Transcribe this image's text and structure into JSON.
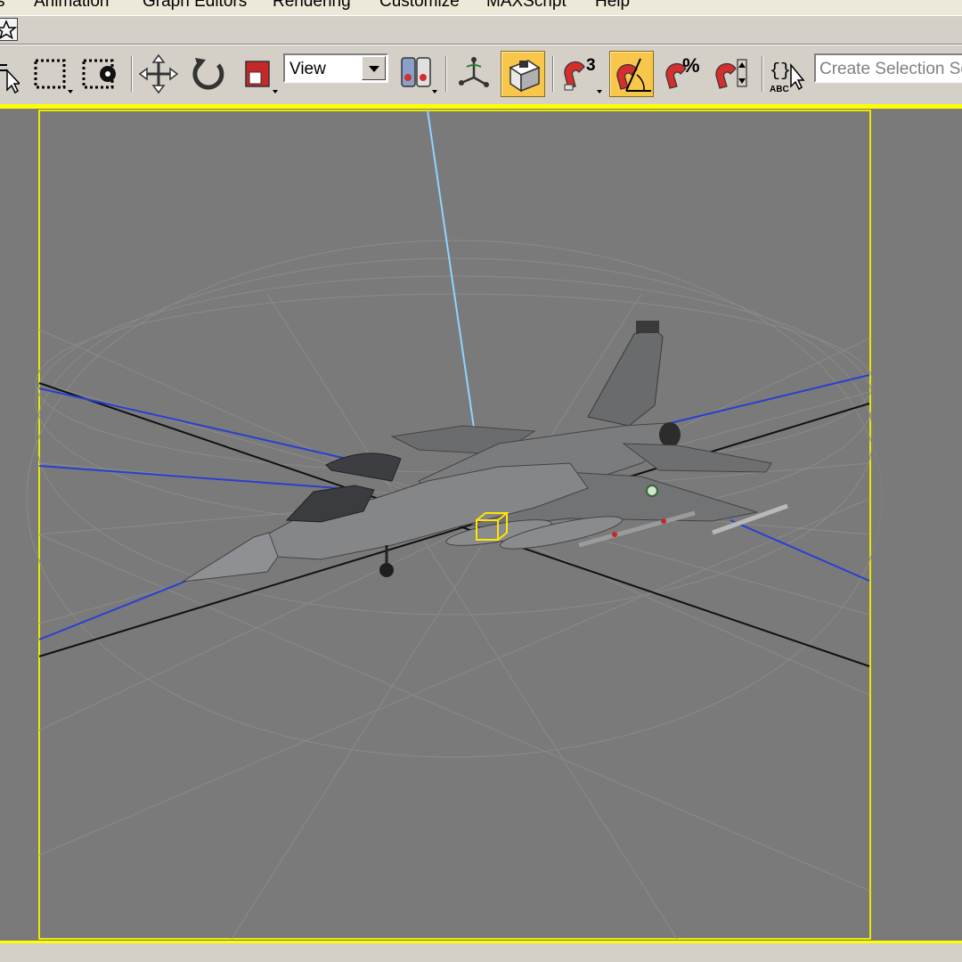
{
  "menubar": {
    "items": [
      {
        "label": "s",
        "name": "menu-views"
      },
      {
        "label": "Animation",
        "name": "menu-animation"
      },
      {
        "label": "Graph Editors",
        "name": "menu-graph-editors"
      },
      {
        "label": "Rendering",
        "name": "menu-rendering"
      },
      {
        "label": "Customize",
        "name": "menu-customize"
      },
      {
        "label": "MAXScript",
        "name": "menu-maxscript"
      },
      {
        "label": "Help",
        "name": "menu-help"
      }
    ]
  },
  "toolbar": {
    "reference_coordinate_system": "View",
    "named_selection_placeholder": "Create Selection Se",
    "snap_3d_label": "3",
    "percent_label": "%",
    "active_tools": [
      "angle-snap-toggle",
      "viewport-shading"
    ]
  },
  "colors": {
    "active_viewport_border": "#ffff00",
    "toolbar_bg": "#d4d0c8",
    "viewport_bg": "#7a7a7a",
    "active_button": "#f7c64a",
    "axis_blue": "#2a3fd0",
    "axis_cyan": "#8fd4ff",
    "axis_black": "#111111"
  },
  "viewport": {
    "object": "fighter-jet-model",
    "selection_gizmo": "yellow-box-gizmo"
  }
}
